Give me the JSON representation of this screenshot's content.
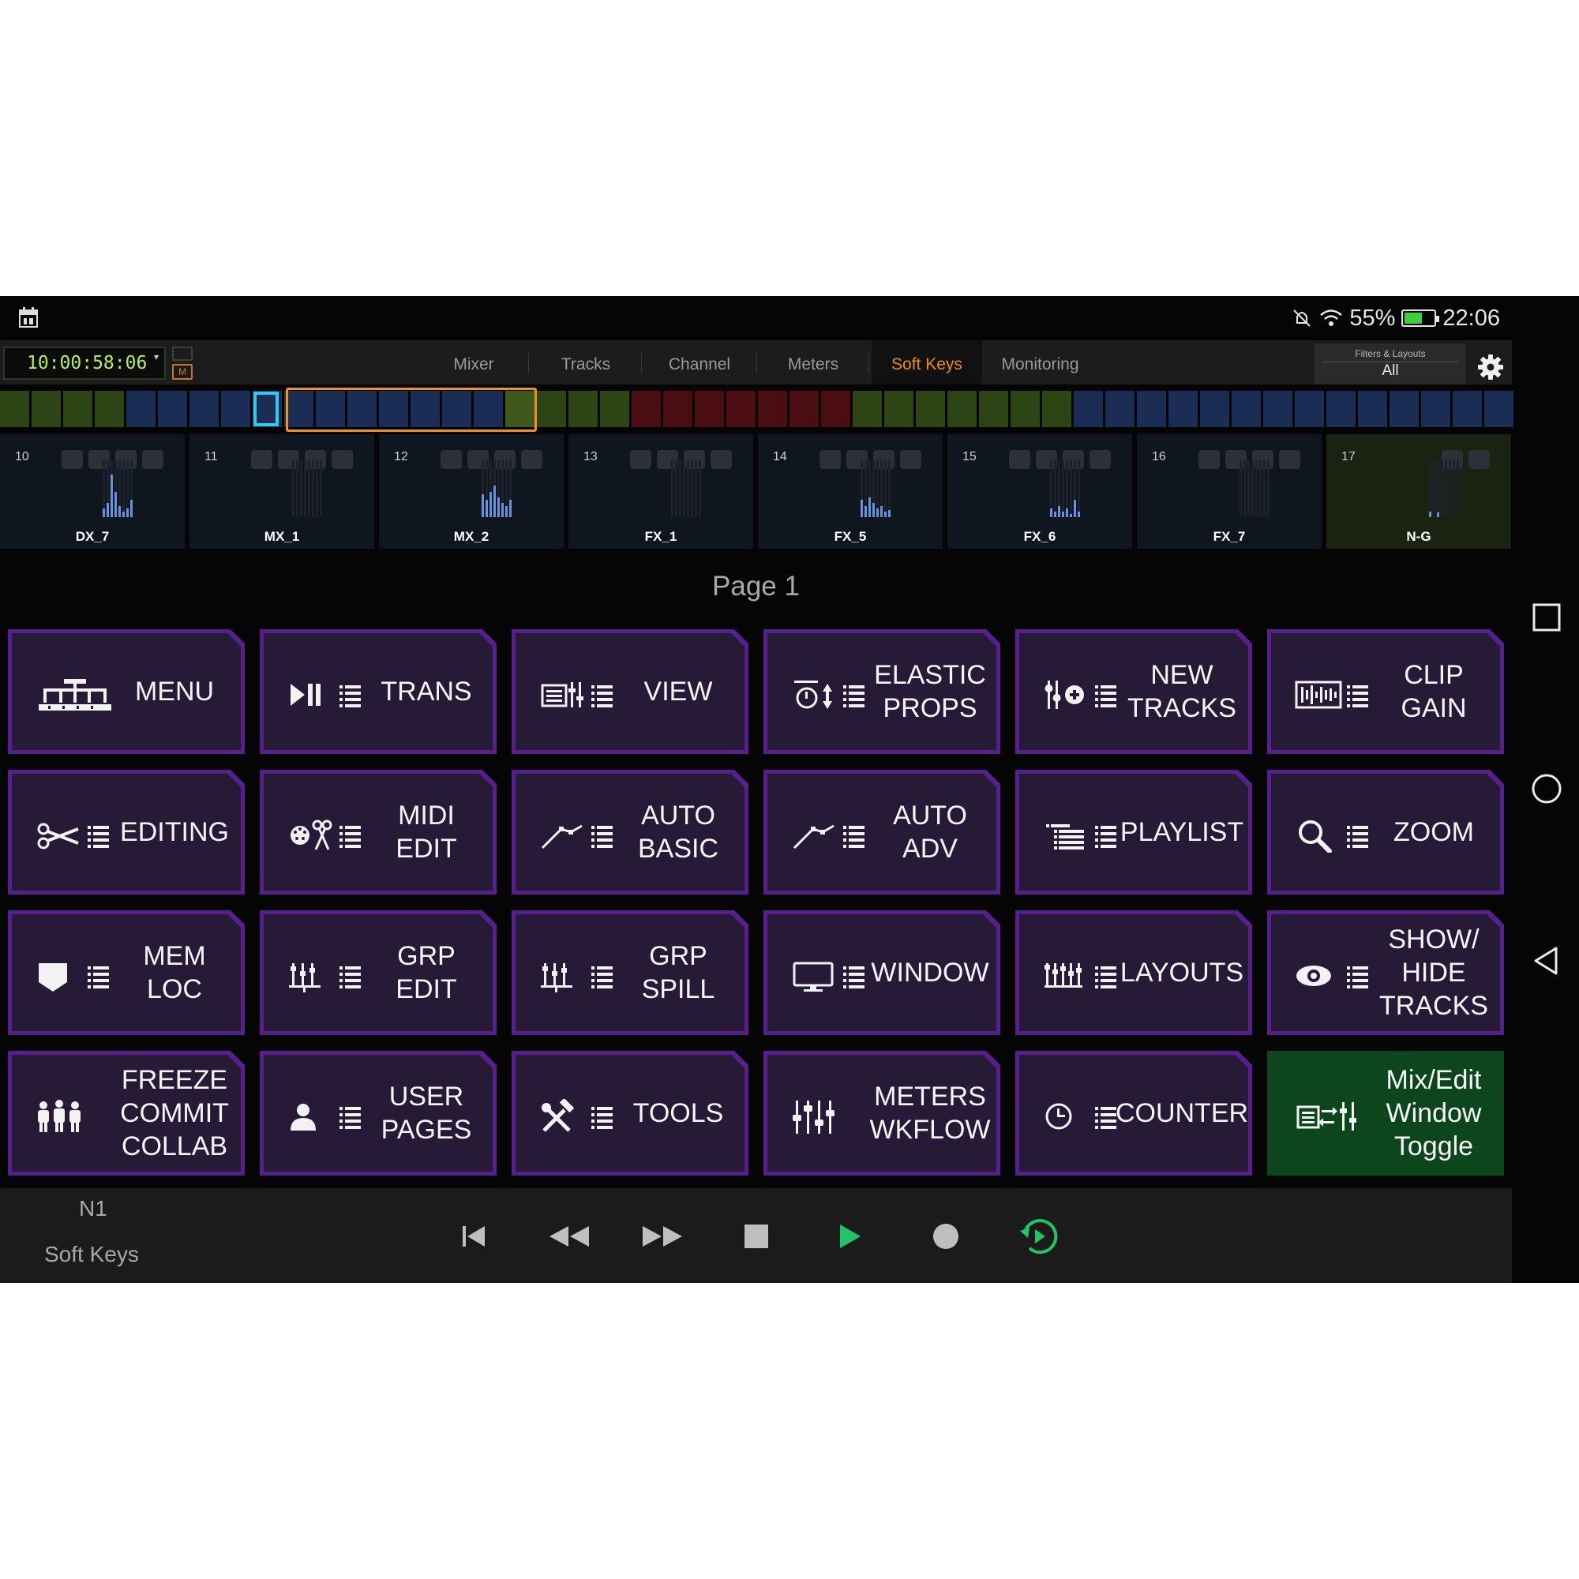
{
  "status_bar": {
    "battery": "55%",
    "time": "22:06"
  },
  "timecode": {
    "value": "10:00:58:06",
    "m_label": "M"
  },
  "tabs": [
    {
      "label": "Mixer",
      "active": false
    },
    {
      "label": "Tracks",
      "active": false
    },
    {
      "label": "Channel",
      "active": false
    },
    {
      "label": "Meters",
      "active": false
    },
    {
      "label": "Soft Keys",
      "active": true
    },
    {
      "label": "Monitoring",
      "active": false
    }
  ],
  "filters": {
    "title": "Filters & Layouts",
    "value": "All"
  },
  "overview_colors": [
    "#2d4514",
    "#2d4514",
    "#2d4514",
    "#2d4514",
    "#1b2d55",
    "#1b2d55",
    "#1b2d55",
    "#1b2d55",
    "#1b2d55",
    "#1b2d55",
    "#1b2d55",
    "#1b2d55",
    "#1b2d55",
    "#1b2d55",
    "#1b2d55",
    "#1b2d55",
    "#40591a",
    "#2d4514",
    "#2d4514",
    "#2d4514",
    "#4a0d12",
    "#4a0d12",
    "#4a0d12",
    "#4a0d12",
    "#4a0d12",
    "#4a0d12",
    "#4a0d12",
    "#2d4514",
    "#2d4514",
    "#2d4514",
    "#2d4514",
    "#2d4514",
    "#2d4514",
    "#2d4514",
    "#1b2d55",
    "#1b2d55",
    "#1b2d55",
    "#1b2d55",
    "#1b2d55",
    "#1b2d55",
    "#1b2d55",
    "#1b2d55",
    "#1b2d55",
    "#1b2d55",
    "#1b2d55",
    "#1b2d55",
    "#1b2d55",
    "#1b2d55"
  ],
  "channels": [
    {
      "number": "10",
      "name": "DX_7",
      "meters": [
        0.15,
        0.25,
        0.75,
        0.45,
        0.2,
        0.1,
        0.15,
        0.3
      ],
      "buttons": 4,
      "highlight": false
    },
    {
      "number": "11",
      "name": "MX_1",
      "meters": [
        0,
        0,
        0,
        0,
        0,
        0,
        0,
        0
      ],
      "buttons": 4,
      "highlight": false
    },
    {
      "number": "12",
      "name": "MX_2",
      "meters": [
        0.4,
        0.3,
        0.45,
        0.55,
        0.35,
        0.25,
        0.2,
        0.3
      ],
      "buttons": 4,
      "highlight": false
    },
    {
      "number": "13",
      "name": "FX_1",
      "meters": [
        0,
        0,
        0,
        0,
        0,
        0,
        0,
        0
      ],
      "buttons": 4,
      "highlight": false
    },
    {
      "number": "14",
      "name": "FX_5",
      "meters": [
        0.3,
        0.2,
        0.35,
        0.25,
        0.15,
        0.2,
        0.1,
        0.12
      ],
      "buttons": 4,
      "highlight": false
    },
    {
      "number": "15",
      "name": "FX_6",
      "meters": [
        0.15,
        0.1,
        0.2,
        0.1,
        0.15,
        0.05,
        0.3,
        0.1
      ],
      "buttons": 4,
      "highlight": false
    },
    {
      "number": "16",
      "name": "FX_7",
      "meters": [
        0,
        0,
        0,
        0,
        0,
        0,
        0,
        0
      ],
      "buttons": 4,
      "highlight": false
    },
    {
      "number": "17",
      "name": "N-G",
      "meters": [
        0.1,
        0,
        0.08,
        0,
        0,
        0,
        0,
        0
      ],
      "buttons": 2,
      "highlight": true
    }
  ],
  "page_label": "Page 1",
  "soft_keys": [
    {
      "label": "MENU",
      "icon": "menu-icon",
      "green": false
    },
    {
      "label": "TRANS",
      "icon": "transport-icon",
      "green": false
    },
    {
      "label": "VIEW",
      "icon": "view-icon",
      "green": false
    },
    {
      "label": "ELASTIC\nPROPS",
      "icon": "elastic-icon",
      "green": false
    },
    {
      "label": "NEW\nTRACKS",
      "icon": "new-tracks-icon",
      "green": false
    },
    {
      "label": "CLIP\nGAIN",
      "icon": "clip-gain-icon",
      "green": false
    },
    {
      "label": "EDITING",
      "icon": "scissors-icon",
      "green": false
    },
    {
      "label": "MIDI\nEDIT",
      "icon": "midi-edit-icon",
      "green": false
    },
    {
      "label": "AUTO\nBASIC",
      "icon": "automation-icon",
      "green": false
    },
    {
      "label": "AUTO\nADV",
      "icon": "automation-icon",
      "green": false
    },
    {
      "label": "PLAYLIST",
      "icon": "playlist-icon",
      "green": false
    },
    {
      "label": "ZOOM",
      "icon": "magnifier-icon",
      "green": false
    },
    {
      "label": "MEM\nLOC",
      "icon": "marker-icon",
      "green": false
    },
    {
      "label": "GRP\nEDIT",
      "icon": "group-icon",
      "green": false
    },
    {
      "label": "GRP\nSPILL",
      "icon": "group-icon",
      "green": false
    },
    {
      "label": "WINDOW",
      "icon": "monitor-icon",
      "green": false
    },
    {
      "label": "LAYOUTS",
      "icon": "layouts-icon",
      "green": false
    },
    {
      "label": "SHOW/\nHIDE\nTRACKS",
      "icon": "eye-icon",
      "green": false
    },
    {
      "label": "FREEZE\nCOMMIT\nCOLLAB",
      "icon": "people-icon",
      "green": false
    },
    {
      "label": "USER\nPAGES",
      "icon": "user-icon",
      "green": false
    },
    {
      "label": "TOOLS",
      "icon": "tools-icon",
      "green": false
    },
    {
      "label": "METERS\nWKFLOW",
      "icon": "faders-icon",
      "green": false
    },
    {
      "label": "COUNTER",
      "icon": "clock-icon",
      "green": false
    },
    {
      "label": "Mix/Edit\nWindow\nToggle",
      "icon": "mix-edit-icon",
      "green": true
    }
  ],
  "transport": {
    "bank": "N1",
    "mode": "Soft Keys",
    "buttons": [
      "return-to-zero-icon",
      "rewind-icon",
      "fast-forward-icon",
      "stop-icon",
      "play-icon",
      "record-icon",
      "loop-play-icon"
    ]
  },
  "colors": {
    "key_border": "#561f8c",
    "key_fill": "#271a37",
    "key_green": "#0d461d",
    "active_tab": "#f08a20",
    "timecode": "#b7ef5a",
    "play": "#22c46a"
  }
}
